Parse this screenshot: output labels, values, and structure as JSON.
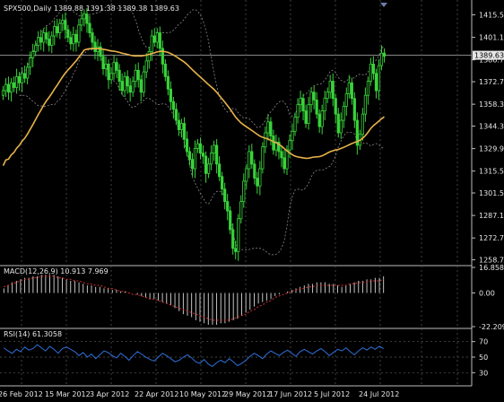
{
  "window": {
    "symbol_header": "SPX500,Daily  1389.88 1391.38 1389.38 1389.63",
    "macd_header": "MACD(12,26,9) 10.913 7.969",
    "rsi_header": "RSI(14) 61.3058"
  },
  "colors": {
    "background": "#000000",
    "candle": "#39d23a",
    "moving_average": "#e8b24a",
    "bands": "#8a8a8a",
    "grid": "#5a5a5a",
    "macd_signal": "#d03030",
    "macd_hist": "#d8d8d8",
    "rsi_line": "#2f6fd8",
    "text": "#e6e6e6"
  },
  "price_axis": [
    "1415.50",
    "1401.10",
    "1386.70",
    "1372.70",
    "1358.30",
    "1344.30",
    "1329.90",
    "1315.50",
    "1301.50",
    "1287.10",
    "1272.70",
    "1258.70"
  ],
  "current_price": "1389.63",
  "macd_axis": [
    "16.858",
    "0.00",
    "-22.209"
  ],
  "rsi_axis": [
    "70",
    "50",
    "30"
  ],
  "date_axis": [
    "26 Feb 2012",
    "15 Mar 2012",
    "3 Apr 2012",
    "22 Apr 2012",
    "10 May 2012",
    "29 May 2012",
    "17 Jun 2012",
    "5 Jul 2012",
    "24 Jul 2012"
  ],
  "chart_data": [
    {
      "type": "candlestick",
      "title": "SPX500,Daily",
      "ohlc_last": {
        "open": 1389.88,
        "high": 1391.38,
        "low": 1389.38,
        "close": 1389.63
      },
      "ylim": [
        1255,
        1425
      ],
      "closes": [
        1367,
        1371,
        1366,
        1372,
        1369,
        1376,
        1372,
        1378,
        1375,
        1382,
        1388,
        1392,
        1396,
        1401,
        1398,
        1404,
        1400,
        1396,
        1402,
        1408,
        1404,
        1410,
        1412,
        1406,
        1401,
        1397,
        1403,
        1398,
        1409,
        1413,
        1416,
        1410,
        1404,
        1398,
        1392,
        1395,
        1389,
        1381,
        1384,
        1374,
        1378,
        1385,
        1380,
        1373,
        1367,
        1376,
        1370,
        1366,
        1373,
        1380,
        1374,
        1366,
        1379,
        1386,
        1392,
        1402,
        1398,
        1404,
        1394,
        1384,
        1376,
        1368,
        1360,
        1355,
        1348,
        1342,
        1346,
        1336,
        1328,
        1323,
        1317,
        1330,
        1333,
        1327,
        1325,
        1314,
        1320,
        1327,
        1332,
        1320,
        1312,
        1304,
        1296,
        1290,
        1278,
        1266,
        1264,
        1285,
        1296,
        1309,
        1317,
        1328,
        1320,
        1311,
        1306,
        1317,
        1331,
        1340,
        1347,
        1338,
        1329,
        1334,
        1328,
        1324,
        1317,
        1329,
        1335,
        1341,
        1350,
        1358,
        1362,
        1354,
        1346,
        1358,
        1366,
        1361,
        1352,
        1344,
        1354,
        1362,
        1366,
        1373,
        1362,
        1352,
        1340,
        1348,
        1357,
        1365,
        1372,
        1362,
        1348,
        1332,
        1339,
        1352,
        1364,
        1373,
        1384,
        1378,
        1367,
        1383,
        1391,
        1389
      ]
    },
    {
      "type": "line",
      "title": "MACD(12,26,9)",
      "values_last": {
        "macd": 10.913,
        "signal": 7.969
      },
      "ylim": [
        -22.209,
        16.858
      ],
      "histogram": [
        3,
        5,
        7,
        8,
        9,
        10,
        10,
        11,
        11,
        12,
        12,
        12,
        12,
        11,
        10,
        9,
        8,
        8,
        7,
        6,
        5,
        5,
        4,
        4,
        3,
        3,
        2,
        2,
        1,
        1,
        0,
        0,
        -1,
        -2,
        -3,
        -4,
        -4,
        -5,
        -6,
        -7,
        -8,
        -10,
        -12,
        -14,
        -15,
        -16,
        -18,
        -19,
        -20,
        -21,
        -21,
        -21,
        -20,
        -20,
        -19,
        -18,
        -17,
        -15,
        -13,
        -11,
        -9,
        -7,
        -6,
        -5,
        -4,
        -2,
        -1,
        0,
        1,
        2,
        3,
        4,
        5,
        6,
        6,
        7,
        7,
        7,
        6,
        6,
        5,
        4,
        5,
        6,
        7,
        8,
        8,
        9,
        9,
        10,
        10,
        11
      ],
      "signal": [
        4,
        5,
        6,
        7,
        8,
        9,
        9,
        10,
        10,
        11,
        11,
        11,
        11,
        10,
        10,
        9,
        9,
        8,
        8,
        7,
        6,
        6,
        5,
        5,
        4,
        3,
        3,
        2,
        1,
        1,
        0,
        -1,
        -1,
        -2,
        -3,
        -4,
        -4,
        -5,
        -6,
        -7,
        -8,
        -9,
        -10,
        -11,
        -12,
        -13,
        -14,
        -15,
        -16,
        -17,
        -18,
        -18,
        -18,
        -18,
        -18,
        -17,
        -16,
        -15,
        -14,
        -12,
        -11,
        -9,
        -8,
        -6,
        -5,
        -3,
        -2,
        -1,
        0,
        1,
        2,
        3,
        3,
        4,
        4,
        5,
        5,
        5,
        5,
        5,
        5,
        5,
        5,
        6,
        6,
        7,
        7,
        7,
        8,
        8,
        8,
        9
      ]
    },
    {
      "type": "line",
      "title": "RSI(14)",
      "values_last": {
        "rsi": 61.3058
      },
      "ylim": [
        0,
        100
      ],
      "gridlines": [
        30,
        50,
        70
      ],
      "values": [
        62,
        58,
        55,
        60,
        57,
        63,
        59,
        61,
        66,
        62,
        58,
        64,
        60,
        55,
        61,
        63,
        60,
        57,
        52,
        56,
        50,
        54,
        48,
        53,
        58,
        56,
        52,
        49,
        55,
        51,
        46,
        52,
        57,
        54,
        50,
        47,
        45,
        50,
        55,
        52,
        48,
        44,
        46,
        50,
        53,
        49,
        44,
        42,
        47,
        41,
        38,
        43,
        46,
        43,
        48,
        44,
        39,
        42,
        46,
        51,
        55,
        52,
        48,
        54,
        58,
        55,
        52,
        56,
        59,
        55,
        51,
        57,
        60,
        57,
        54,
        58,
        61,
        57,
        52,
        56,
        60,
        58,
        62,
        57,
        53,
        58,
        62,
        59,
        63,
        60,
        64,
        61
      ]
    }
  ]
}
